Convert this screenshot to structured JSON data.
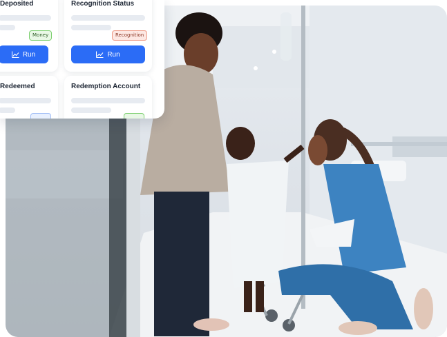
{
  "panel": {
    "cards": [
      {
        "title": "Deposited",
        "tag": "Money",
        "button": "Run"
      },
      {
        "title": "Recognition Status",
        "tag": "Recognition",
        "button": "Run"
      },
      {
        "title": "Redeemed"
      },
      {
        "title": "Redemption Account"
      }
    ]
  },
  "colors": {
    "accent": "#2b6cf6",
    "money_tag_bg": "#e9f8e6",
    "money_tag_border": "#7ccf6f",
    "recognition_tag_bg": "#fde8e3",
    "recognition_tag_border": "#ee9a86"
  },
  "icons": {
    "run_icon": "line-chart-icon"
  }
}
